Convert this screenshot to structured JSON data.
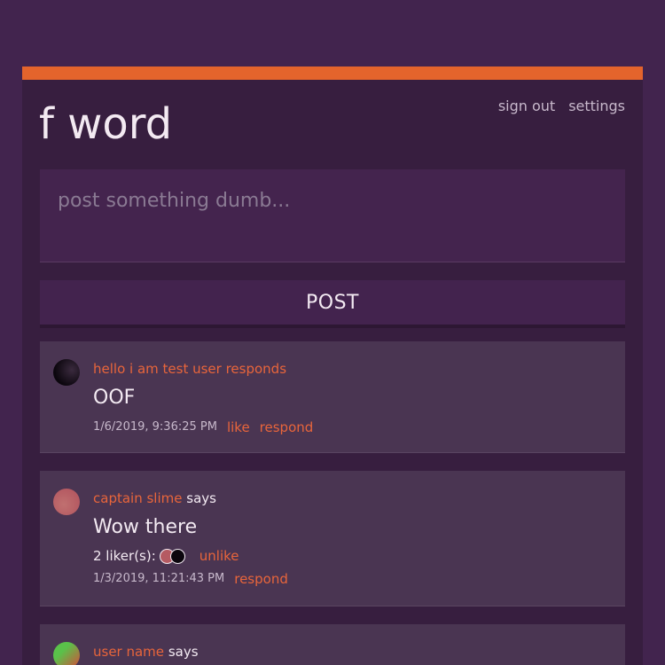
{
  "app": {
    "logo": "f word",
    "nav": {
      "sign_out": "sign out",
      "settings": "settings"
    },
    "colors": {
      "accent": "#e4642c",
      "background": "#42244e",
      "card": "#371e3f",
      "post": "#4a3552"
    }
  },
  "composer": {
    "placeholder": "post something dumb...",
    "value": "",
    "post_label": "POST"
  },
  "posts": [
    {
      "avatar": "dark-avatar",
      "author": "hello i am test user responds",
      "verb": "",
      "text": "OOF",
      "timestamp": "1/6/2019, 9:36:25 PM",
      "like_label": "like",
      "respond_label": "respond"
    },
    {
      "avatar": "slime-avatar",
      "author": "captain slime",
      "verb": "says",
      "text": "Wow there",
      "likers_label": "2 liker(s):",
      "unlike_label": "unlike",
      "timestamp": "1/3/2019, 11:21:43 PM",
      "respond_label": "respond"
    },
    {
      "avatar": "green-avatar",
      "author": "user name",
      "verb": "says"
    }
  ]
}
